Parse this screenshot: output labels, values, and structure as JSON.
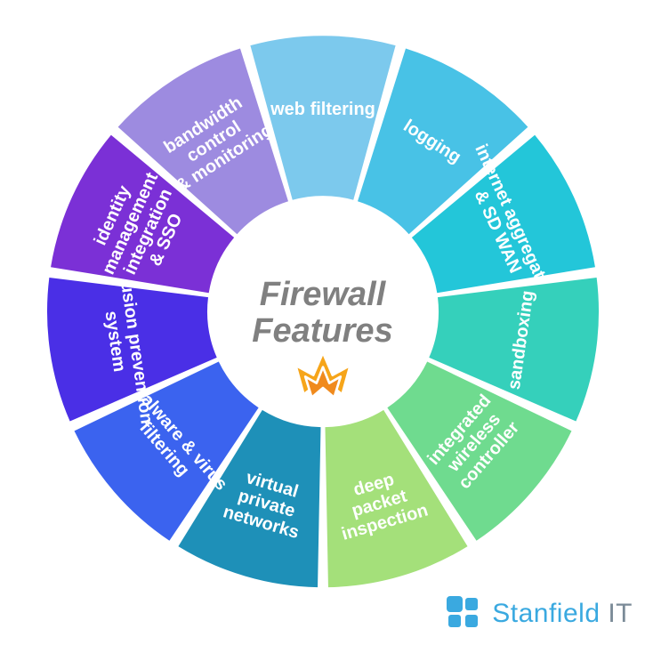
{
  "chart_data": {
    "type": "pie",
    "title": "Firewall Features",
    "series": [
      {
        "name": "web filtering",
        "color": "#7cc9ed"
      },
      {
        "name": "logging",
        "color": "#48c2e6"
      },
      {
        "name": "internet aggregation & SD WAN",
        "color": "#23c6d9"
      },
      {
        "name": "sandboxing",
        "color": "#35d0bb"
      },
      {
        "name": "integrated wireless controller",
        "color": "#6fdb8f"
      },
      {
        "name": "deep packet inspection",
        "color": "#a4e07a"
      },
      {
        "name": "virtual private networks",
        "color": "#1e90b8"
      },
      {
        "name": "malware & virus filtering",
        "color": "#3b63ef"
      },
      {
        "name": "intrusion prevention system",
        "color": "#4a2fe6"
      },
      {
        "name": "identity management integration & SSO",
        "color": "#7b30d6"
      },
      {
        "name": "bandwidth control & monitoring",
        "color": "#9d8be0"
      }
    ],
    "notes": "Equal-slice radial feature wheel; slices carry no numeric value."
  },
  "center": {
    "line1": "Firewall",
    "line2": "Features"
  },
  "icon": {
    "name": "firewall-flame-icon"
  },
  "segments": [
    {
      "lines": [
        "web filtering"
      ],
      "color": "#7cc9ed"
    },
    {
      "lines": [
        "logging"
      ],
      "color": "#48c2e6"
    },
    {
      "lines": [
        "internet aggregation",
        "& SD WAN"
      ],
      "color": "#23c6d9"
    },
    {
      "lines": [
        "sandboxing"
      ],
      "color": "#35d0bb"
    },
    {
      "lines": [
        "integrated",
        "wireless",
        "controller"
      ],
      "color": "#6fdb8f"
    },
    {
      "lines": [
        "deep",
        "packet",
        "inspection"
      ],
      "color": "#a4e07a"
    },
    {
      "lines": [
        "virtual",
        "private",
        "networks"
      ],
      "color": "#1e90b8"
    },
    {
      "lines": [
        "malware & virus",
        "filtering"
      ],
      "color": "#3b63ef"
    },
    {
      "lines": [
        "intrusion prevention",
        "system"
      ],
      "color": "#4a2fe6"
    },
    {
      "lines": [
        "identity",
        "management",
        "integration",
        "& SSO"
      ],
      "color": "#7b30d6"
    },
    {
      "lines": [
        "bandwidth",
        "control",
        "& monitoring"
      ],
      "color": "#9d8be0"
    }
  ],
  "brand": {
    "name_accent": "Stanfield",
    "name_rest": " IT"
  }
}
